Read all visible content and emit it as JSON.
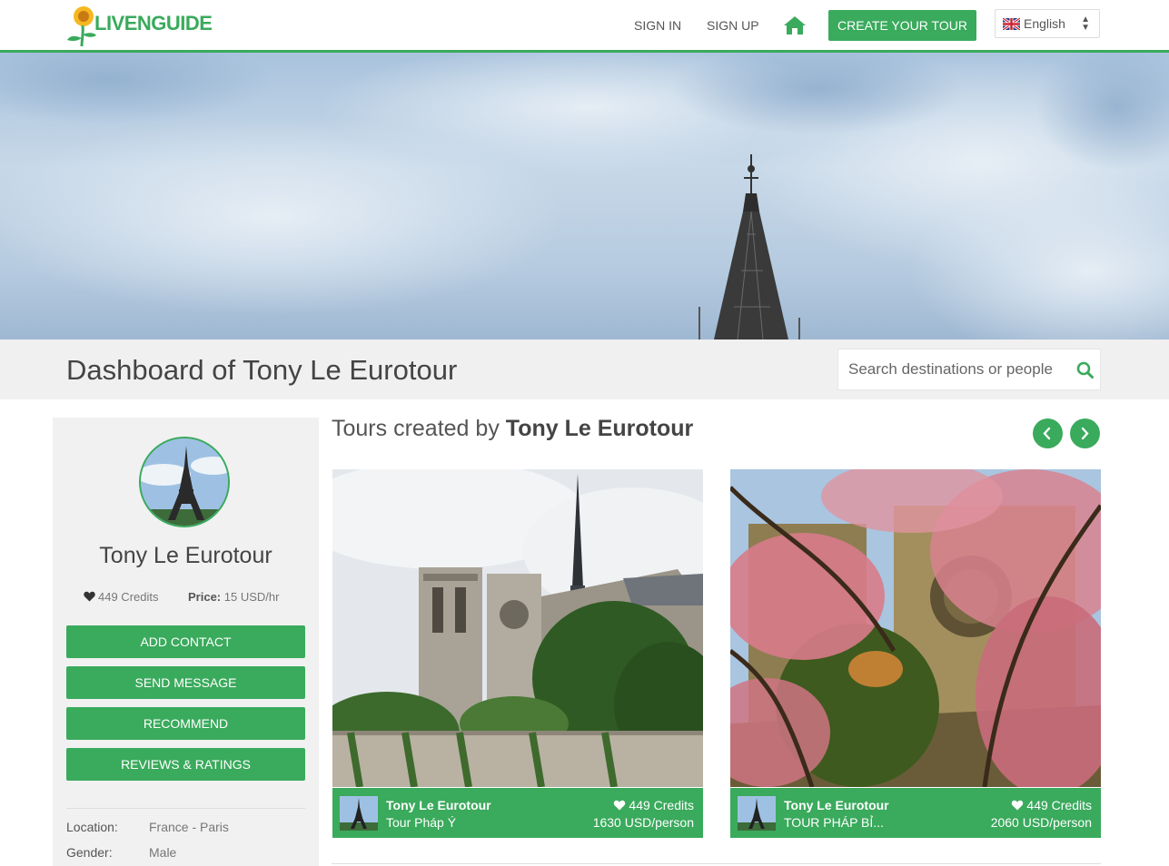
{
  "header": {
    "logo_text": "LIVENGUIDE",
    "sign_in": "SIGN IN",
    "sign_up": "SIGN UP",
    "create_tour": "CREATE YOUR TOUR",
    "language": "English"
  },
  "title_bar": {
    "title": "Dashboard of Tony Le Eurotour",
    "search_placeholder": "Search destinations or people"
  },
  "profile": {
    "name": "Tony Le Eurotour",
    "credits": "449 Credits",
    "price_label": "Price:",
    "price_value": "15 USD/hr",
    "buttons": {
      "add_contact": "ADD CONTACT",
      "send_message": "SEND MESSAGE",
      "recommend": "RECOMMEND",
      "reviews": "REVIEWS & RATINGS"
    },
    "info": [
      {
        "label": "Location:",
        "value": "France - Paris"
      },
      {
        "label": "Gender:",
        "value": "Male"
      }
    ]
  },
  "tours_section": {
    "title_prefix": "Tours created by",
    "title_name": "Tony Le Eurotour"
  },
  "tours": [
    {
      "author": "Tony Le Eurotour",
      "name": "Tour Pháp Ý",
      "credits": "449 Credits",
      "price": "1630 USD/person"
    },
    {
      "author": "Tony Le Eurotour",
      "name": "TOUR PHÁP BỈ...",
      "credits": "449 Credits",
      "price": "2060 USD/person"
    }
  ],
  "colors": {
    "accent": "#3aaa5c",
    "title_bar_bg": "#f0f0f0",
    "sidebar_bg": "#f1f1f1"
  }
}
